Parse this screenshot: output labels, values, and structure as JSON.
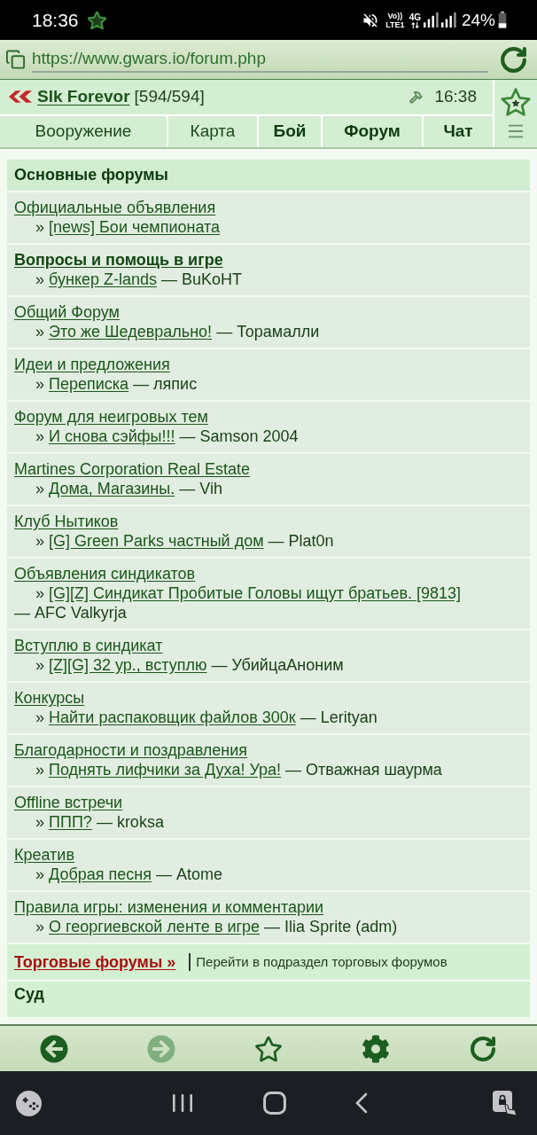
{
  "status_bar": {
    "time": "18:36",
    "volte": "Vo))",
    "lte": "LTE1",
    "network": "4G",
    "battery": "24%"
  },
  "address_bar": {
    "url": "https://www.gwars.io/forum.php"
  },
  "header": {
    "player": "Slk Forevor",
    "health": "[594/594]",
    "clock": "16:38"
  },
  "nav_tabs": [
    {
      "label": "Вооружение",
      "bold": false
    },
    {
      "label": "Карта",
      "bold": false
    },
    {
      "label": "Бой",
      "bold": true
    },
    {
      "label": "Форум",
      "bold": true
    },
    {
      "label": "Чат",
      "bold": true
    }
  ],
  "forum_section": {
    "title": "Основные форумы",
    "forums": [
      {
        "title": "Официальные объявления",
        "bold": false,
        "bullet": "»",
        "topic": "[news] Бои чемпионата"
      },
      {
        "title": "Вопросы и помощь в игре",
        "bold": true,
        "bullet": "»",
        "topic": "бункер Z-lands",
        "author": "— BuKoHT"
      },
      {
        "title": "Общий Форум",
        "bold": false,
        "bullet": "»",
        "topic": "Это же Шедеврально!",
        "author": "— Торамалли"
      },
      {
        "title": "Идеи и предложения",
        "bold": false,
        "bullet": "»",
        "topic": "Переписка",
        "author": "— ляпис"
      },
      {
        "title": "Форум для неигровых тем",
        "bold": false,
        "bullet": "»",
        "topic": "И снова сэйфы!!!",
        "author": "— Samson 2004"
      },
      {
        "title": "Martines Corporation Real Estate",
        "bold": false,
        "bullet": "»",
        "topic": "Дома, Магазины.",
        "author": "— Vih"
      },
      {
        "title": "Клуб Нытиков",
        "bold": false,
        "bullet": "»",
        "topic": "[G] Green Parks частный дом",
        "author": "— Plat0n"
      },
      {
        "title": "Объявления синдикатов",
        "bold": false,
        "bullet": "»",
        "topic": "[G][Z] Синдикат Пробитые Головы ищут братьев. [9813]",
        "author": "— AFC Valkyrja"
      },
      {
        "title": "Вступлю в синдикат",
        "bold": false,
        "bullet": "»",
        "topic": "[Z][G] 32 ур., вступлю",
        "author": "— УбийцаАноним"
      },
      {
        "title": "Конкурсы",
        "bold": false,
        "bullet": "»",
        "topic": "Найти распаковщик файлов 300к",
        "author": "— Lerityan"
      },
      {
        "title": "Благодарности и поздравления",
        "bold": false,
        "bullet": "»",
        "topic": "Поднять лифчики за Духа! Ура!",
        "author": "— Отважная шаурма"
      },
      {
        "title": "Offline встречи",
        "bold": false,
        "bullet": "»",
        "topic": "ППП?",
        "author": "— kroksa"
      },
      {
        "title": "Креатив",
        "bold": false,
        "bullet": "»",
        "topic": "Добрая песня",
        "author": "— Atome"
      },
      {
        "title": "Правила игры: изменения и комментарии",
        "bold": false,
        "bullet": "»",
        "topic": "О георгиевской ленте в игре",
        "author": "— Ilia Sprite (adm)"
      }
    ]
  },
  "trade_section": {
    "link": "Торговые форумы »",
    "description": "Перейти в подраздел торговых форумов"
  },
  "next_section": {
    "title": "Суд"
  },
  "toolbar": [
    {
      "kind": "back",
      "disabled": false
    },
    {
      "kind": "forward",
      "disabled": true
    },
    {
      "kind": "bookmark",
      "disabled": false
    },
    {
      "kind": "settings",
      "disabled": false
    },
    {
      "kind": "reload",
      "disabled": false
    }
  ]
}
